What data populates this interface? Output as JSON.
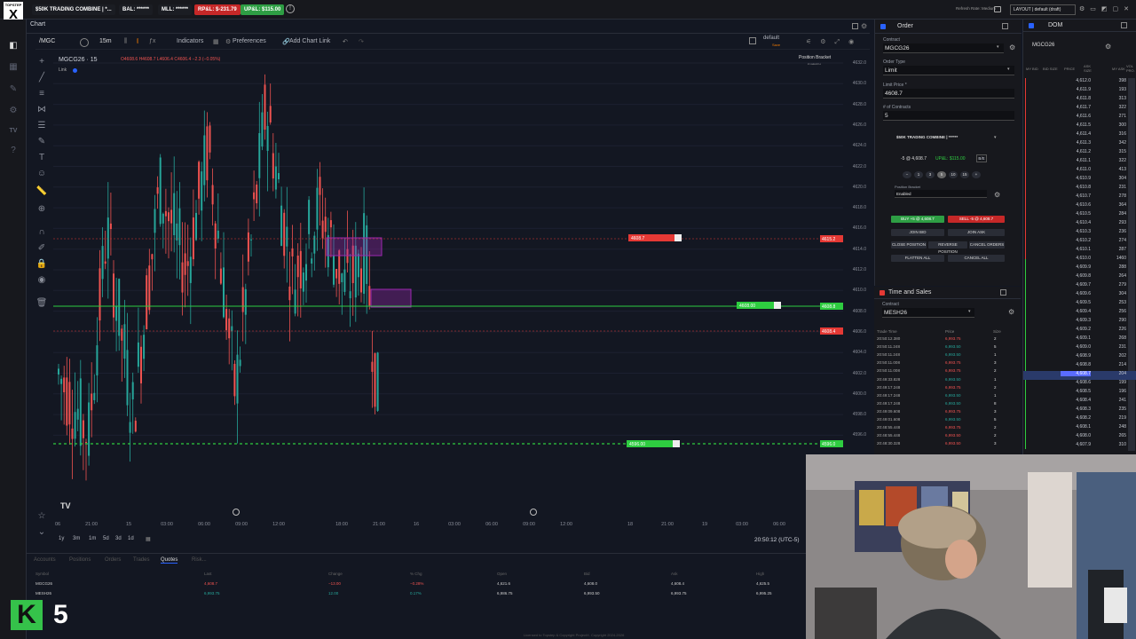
{
  "topbar": {
    "logo": "X",
    "logo_sub": "TOPSTEP",
    "account": "$50K TRADING COMBINE | *...",
    "bal": "BAL: ******",
    "mll": "MLL: ******",
    "rpl": "RP&L: $-231.79",
    "upl": "UP&L: $115.00",
    "refresh_rate": "Refresh Rate: Medium",
    "layout": "LAYOUT | default (draft)"
  },
  "chart": {
    "tab": "Chart",
    "symbol_input": "/MGC",
    "interval": "15m",
    "indicators": "Indicators",
    "preferences": "Preferences",
    "add_link": "Add Chart Link",
    "layout_label": "default",
    "layout_sub": "Save",
    "title": "MGCG26 · 15",
    "link": "Link",
    "position_bracket": "Position Bracket",
    "position_bracket_sub": "Enabled",
    "y_ticks": [
      "4632.0",
      "4630.0",
      "4628.0",
      "4626.0",
      "4624.0",
      "4622.0",
      "4620.0",
      "4618.0",
      "4616.0",
      "4614.0",
      "4612.0",
      "4610.0",
      "4608.0",
      "4606.0",
      "4604.0",
      "4602.0",
      "4600.0",
      "4598.0",
      "4596.0"
    ],
    "x_ticks": [
      "06",
      "21:00",
      "15",
      "03:00",
      "06:00",
      "09:00",
      "12:00",
      "18:00",
      "21:00",
      "16",
      "03:00",
      "06:00",
      "09:00",
      "12:00",
      "18",
      "21:00",
      "19",
      "03:00",
      "06:00"
    ],
    "ranges": [
      "1y",
      "3m",
      "1m",
      "5d",
      "3d",
      "1d"
    ],
    "clock": "20:50:12 (UTC-5)",
    "sell_tag": "4615.2",
    "mgc_tag": "4608.4",
    "green_tag": "4608.8",
    "bottom_tag": "4596.0",
    "chart_buttons": {
      "top_label": "4608.7",
      "green_label": "4608.00",
      "bottom_label": "4596.00"
    }
  },
  "order": {
    "title": "Order",
    "contract_label": "Contract",
    "contract": "MGCG26",
    "type_label": "Order Type",
    "type": "Limit",
    "price_label": "Limit Price *",
    "price": "4608.7",
    "qty_label": "# of Contracts",
    "qty": "5",
    "account": "$50K TRADING COMBINE | ******",
    "pos": "-5 @ 4,608.7",
    "pos_pnl": "UP&L: $115.00",
    "be": "B/E",
    "qty_buttons": [
      "−",
      "1",
      "3",
      "5",
      "10",
      "15",
      "+"
    ],
    "bracket_label": "Position Bracket",
    "bracket": "Enabled",
    "buy": "BUY +5 @ 4,608.7",
    "sell": "SELL -5 @ 4,608.7",
    "join_bid": "JOIN BID",
    "join_ask": "JOIN ASK",
    "close_pos": "CLOSE POSITION",
    "reverse_pos": "REVERSE POSITION",
    "cancel_orders": "CANCEL ORDERS",
    "flatten_all": "FLATTEN ALL",
    "cancel_all": "CANCEL ALL"
  },
  "dom": {
    "title": "DOM",
    "contract": "MGCG26",
    "headers": [
      "MY BID",
      "BID SIZE",
      "PRICE",
      "ASK SIZE",
      "MY ASK",
      "VOL PRO."
    ],
    "rows": [
      [
        "4,612.0",
        "398"
      ],
      [
        "4,611.9",
        "193"
      ],
      [
        "4,611.8",
        "313"
      ],
      [
        "4,611.7",
        "322"
      ],
      [
        "4,611.6",
        "271"
      ],
      [
        "4,611.5",
        "300"
      ],
      [
        "4,611.4",
        "316"
      ],
      [
        "4,611.3",
        "342"
      ],
      [
        "4,611.2",
        "315"
      ],
      [
        "4,611.1",
        "322"
      ],
      [
        "4,611.0",
        "413"
      ],
      [
        "4,610.9",
        "304"
      ],
      [
        "4,610.8",
        "231"
      ],
      [
        "4,610.7",
        "278"
      ],
      [
        "4,610.6",
        "364"
      ],
      [
        "4,610.5",
        "284"
      ],
      [
        "4,610.4",
        "293"
      ],
      [
        "4,610.3",
        "236"
      ],
      [
        "4,610.2",
        "274"
      ],
      [
        "4,610.1",
        "287"
      ],
      [
        "4,610.0",
        "1460"
      ],
      [
        "4,609.9",
        "288"
      ],
      [
        "4,609.8",
        "264"
      ],
      [
        "4,609.7",
        "279"
      ],
      [
        "4,609.6",
        "304"
      ],
      [
        "4,609.5",
        "253"
      ],
      [
        "4,609.4",
        "256"
      ],
      [
        "4,609.3",
        "290"
      ],
      [
        "4,609.2",
        "226"
      ],
      [
        "4,609.1",
        "268"
      ],
      [
        "4,609.0",
        "231"
      ],
      [
        "4,608.9",
        "202"
      ],
      [
        "4,608.8",
        "214"
      ],
      [
        "4,608.7",
        "204"
      ],
      [
        "4,608.6",
        "199"
      ],
      [
        "4,608.5",
        "196"
      ],
      [
        "4,608.4",
        "241"
      ],
      [
        "4,608.3",
        "235"
      ],
      [
        "4,608.2",
        "219"
      ],
      [
        "4,608.1",
        "248"
      ],
      [
        "4,608.0",
        "265"
      ],
      [
        "4,607.9",
        "310"
      ]
    ]
  },
  "ts": {
    "title": "Time and Sales",
    "contract_label": "Contract",
    "contract": "MESH26",
    "headers": [
      "Trade Time",
      "Price",
      "Size"
    ],
    "rows": [
      [
        "20:50:12.380",
        "6,993.75",
        "2",
        "r"
      ],
      [
        "20:50:11.248",
        "6,993.50",
        "5",
        "g"
      ],
      [
        "20:50:11.248",
        "6,993.50",
        "1",
        "g"
      ],
      [
        "20:50:11.008",
        "6,993.75",
        "3",
        "r"
      ],
      [
        "20:50:11.008",
        "6,993.75",
        "2",
        "r"
      ],
      [
        "20:49:33.828",
        "6,993.50",
        "1",
        "g"
      ],
      [
        "20:49:17.248",
        "6,993.75",
        "2",
        "r"
      ],
      [
        "20:49:17.248",
        "6,993.50",
        "1",
        "g"
      ],
      [
        "20:49:17.248",
        "6,993.50",
        "8",
        "g"
      ],
      [
        "20:49:09.608",
        "6,993.75",
        "3",
        "r"
      ],
      [
        "20:49:01.608",
        "6,993.50",
        "5",
        "g"
      ],
      [
        "20:48:55.448",
        "6,993.75",
        "2",
        "r"
      ],
      [
        "20:48:55.448",
        "6,993.50",
        "2",
        "r"
      ],
      [
        "20:48:30.328",
        "6,993.50",
        "3",
        "r"
      ]
    ]
  },
  "quotes": {
    "tabs": [
      "Accounts",
      "Positions",
      "Orders",
      "Trades",
      "Quotes",
      "Risk..."
    ],
    "headers": [
      "Symbol",
      "Last",
      "Change",
      "% Chg",
      "Open",
      "Bid",
      "Ask",
      "High"
    ],
    "rows": [
      [
        "MGCG26",
        "4,608.7",
        "−13.00",
        "−0.28%",
        "4,621.6",
        "4,608.0",
        "4,608.4",
        "4,625.5"
      ],
      [
        "MESH26",
        "6,993.75",
        "12.00",
        "0.17%",
        "6,986.75",
        "6,993.50",
        "6,993.75",
        "6,995.25"
      ]
    ],
    "footer": "Licensed to Topstep & Copyright ProjectX. Copyright 2024-2026"
  },
  "badge": {
    "k": "K",
    "five": "5"
  },
  "colors": {
    "up": "#26a69a",
    "down": "#ef5350",
    "accent": "#2962ff",
    "green": "#2ecc40",
    "red": "#e53935"
  }
}
